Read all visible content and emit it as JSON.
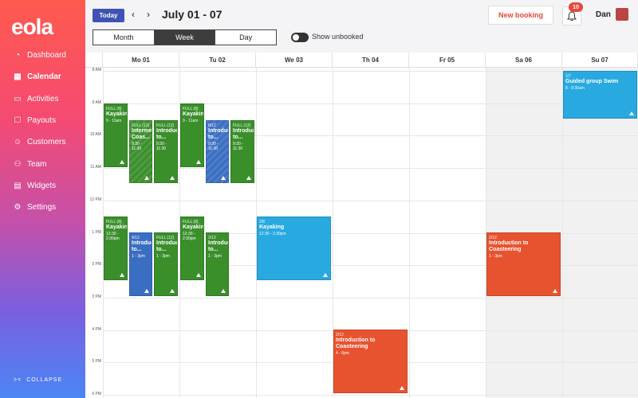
{
  "app": {
    "logo": "eola"
  },
  "sidebar": {
    "items": [
      {
        "label": "Dashboard",
        "icon": "dashboard-icon",
        "glyph": "◔"
      },
      {
        "label": "Calendar",
        "icon": "calendar-icon",
        "glyph": "▦"
      },
      {
        "label": "Activities",
        "icon": "activities-icon",
        "glyph": "▭"
      },
      {
        "label": "Payouts",
        "icon": "payouts-icon",
        "glyph": "☐"
      },
      {
        "label": "Customers",
        "icon": "customers-icon",
        "glyph": "☺"
      },
      {
        "label": "Team",
        "icon": "team-icon",
        "glyph": "⚇"
      },
      {
        "label": "Widgets",
        "icon": "widgets-icon",
        "glyph": "▤"
      },
      {
        "label": "Settings",
        "icon": "settings-icon",
        "glyph": "⚙"
      }
    ],
    "active_index": 1,
    "collapse_label": "COLLAPSE"
  },
  "header": {
    "today_label": "Today",
    "prev_label": "‹",
    "next_label": "›",
    "date_range": "July 01 - 07",
    "views": [
      "Month",
      "Week",
      "Day"
    ],
    "active_view": "Week",
    "show_unbooked_label": "Show unbooked",
    "new_booking_label": "New booking",
    "notification_count": "10",
    "user_name": "Dan"
  },
  "calendar": {
    "days": [
      "Mo 01",
      "Tu 02",
      "We 03",
      "Th 04",
      "Fr 05",
      "Sa 06",
      "Su 07"
    ],
    "hours": [
      "8 AM",
      "9 AM",
      "10 AM",
      "11 AM",
      "12 PM",
      "1 PM",
      "2 PM",
      "3 PM",
      "4 PM",
      "5 PM",
      "6 PM"
    ],
    "events": [
      {
        "day": 0,
        "capacity": "FULL (8)",
        "title": "Kayaking",
        "time": "9 - 11am"
      },
      {
        "day": 0,
        "capacity": "FULL (12)",
        "title": "Intermediate Coas...",
        "time": "9:30 - 11:30"
      },
      {
        "day": 0,
        "capacity": "FULL (12)",
        "title": "Introduction to...",
        "time": "9:30 - 11:30"
      },
      {
        "day": 1,
        "capacity": "FULL (8)",
        "title": "Kayaking",
        "time": "9 - 11am"
      },
      {
        "day": 1,
        "capacity": "8/12",
        "title": "Introduction to...",
        "time": "9:30 - 11:30"
      },
      {
        "day": 1,
        "capacity": "FULL (12)",
        "title": "Introduction to...",
        "time": "9:30 - 11:30"
      },
      {
        "day": 0,
        "capacity": "FULL (8)",
        "title": "Kayaking",
        "time": "12:30 - 2:30pm"
      },
      {
        "day": 0,
        "capacity": "9/12",
        "title": "Introduction to...",
        "time": "1 - 3pm"
      },
      {
        "day": 0,
        "capacity": "FULL (12)",
        "title": "Introduction to...",
        "time": "1 - 3pm"
      },
      {
        "day": 1,
        "capacity": "FULL (8)",
        "title": "Kayaking",
        "time": "12:30 - 2:30pm"
      },
      {
        "day": 1,
        "capacity": "2/12",
        "title": "Introduction to...",
        "time": "1 - 3pm"
      },
      {
        "day": 2,
        "capacity": "2/8",
        "title": "Kayaking",
        "time": "12:30 - 2:30pm"
      },
      {
        "day": 3,
        "capacity": "2/12",
        "title": "Introduction to Coasteering",
        "time": "4 - 6pm"
      },
      {
        "day": 5,
        "capacity": "2/12",
        "title": "Introduction to Coasteering",
        "time": "1 - 3pm"
      },
      {
        "day": 6,
        "capacity": "1/7",
        "title": "Guided group Swim",
        "time": "8 - 9:30am"
      }
    ]
  },
  "colors": {
    "green": "#3a8f2b",
    "blue": "#3a6ec2",
    "sky": "#28a9e0",
    "orange": "#e8532f",
    "brand": "#3f52b5",
    "accent": "#e8483b"
  }
}
